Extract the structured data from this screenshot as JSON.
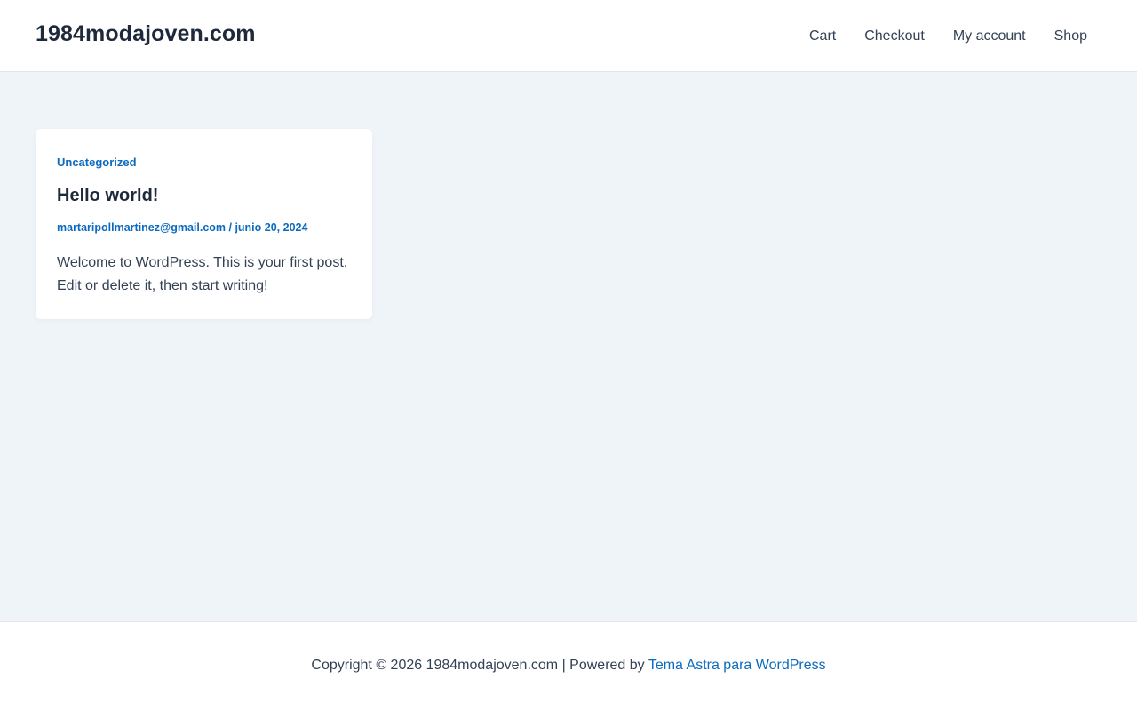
{
  "header": {
    "site_title": "1984modajoven.com",
    "nav": [
      {
        "label": "Cart"
      },
      {
        "label": "Checkout"
      },
      {
        "label": "My account"
      },
      {
        "label": "Shop"
      }
    ]
  },
  "post": {
    "category": "Uncategorized",
    "title": "Hello world!",
    "author": "martaripollmartinez@gmail.com",
    "separator": " / ",
    "date": "junio 20, 2024",
    "excerpt": "Welcome to WordPress. This is your first post. Edit or delete it, then start writing!"
  },
  "footer": {
    "copyright": "Copyright © 2026 1984modajoven.com | Powered by ",
    "theme_link": "Tema Astra para WordPress"
  },
  "colors": {
    "accent": "#0d6bbf",
    "content_background": "#eff4f8",
    "text": "#334155",
    "heading": "#1e293b"
  }
}
